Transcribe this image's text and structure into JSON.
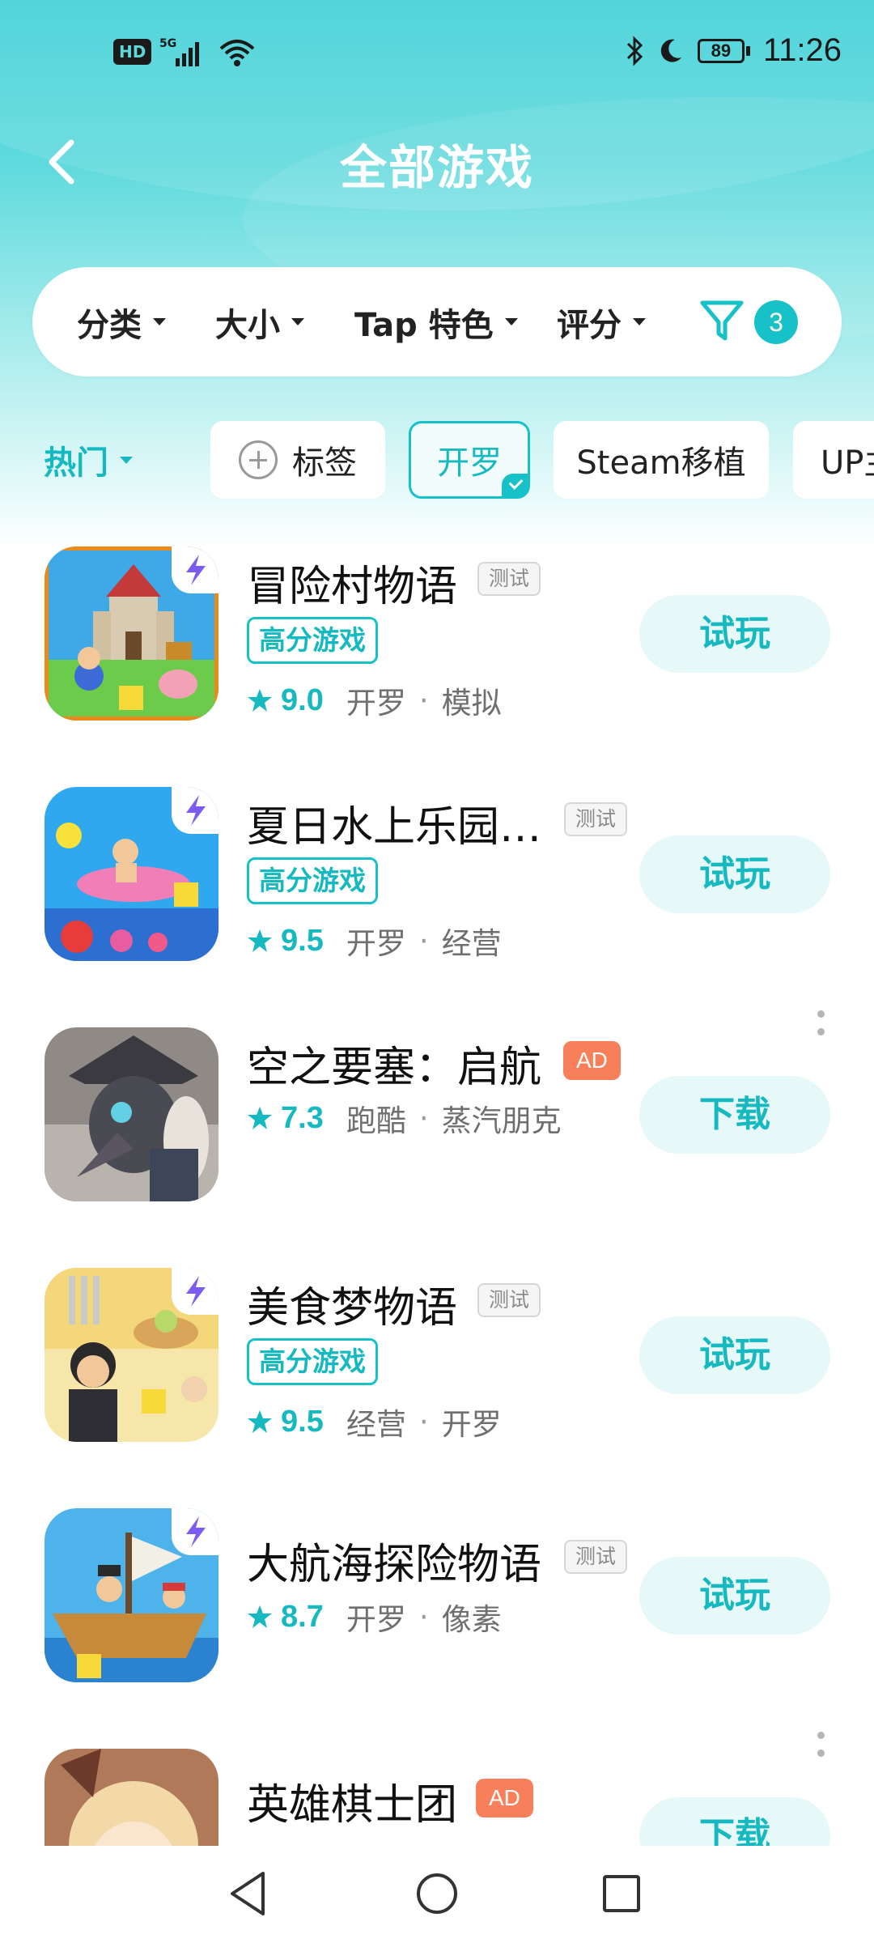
{
  "status_bar": {
    "hd": "HD",
    "network": "5G",
    "battery": "89",
    "time": "11:26"
  },
  "header": {
    "title": "全部游戏"
  },
  "filters": {
    "items": [
      {
        "label": "分类"
      },
      {
        "label": "大小"
      },
      {
        "label": "Tap 特色"
      },
      {
        "label": "评分"
      }
    ],
    "active_count": "3"
  },
  "tags": {
    "sort": "热门",
    "items": [
      {
        "label": "标签"
      },
      {
        "label": "开罗",
        "selected": true
      },
      {
        "label": "Steam移植"
      },
      {
        "label": "UP主"
      }
    ]
  },
  "games": [
    {
      "title": "冒险村物语",
      "badge": "测试",
      "quality_tag": "高分游戏",
      "score": "9.0",
      "tags": [
        "开罗",
        "模拟"
      ],
      "action": "试玩"
    },
    {
      "title": "夏日水上乐园…",
      "badge": "测试",
      "quality_tag": "高分游戏",
      "score": "9.5",
      "tags": [
        "开罗",
        "经营"
      ],
      "action": "试玩"
    },
    {
      "title": "空之要塞：启航",
      "badge": "AD",
      "score": "7.3",
      "tags": [
        "跑酷",
        "蒸汽朋克"
      ],
      "action": "下载"
    },
    {
      "title": "美食梦物语",
      "badge": "测试",
      "quality_tag": "高分游戏",
      "score": "9.5",
      "tags": [
        "经营",
        "开罗"
      ],
      "action": "试玩"
    },
    {
      "title": "大航海探险物语",
      "badge": "测试",
      "score": "8.7",
      "tags": [
        "开罗",
        "像素"
      ],
      "action": "试玩"
    },
    {
      "title": "英雄棋士团",
      "badge": "AD",
      "action": "下载"
    }
  ],
  "colors": {
    "accent": "#16c2c8",
    "ad": "#f7805a",
    "button_bg": "#e6f8f8"
  }
}
